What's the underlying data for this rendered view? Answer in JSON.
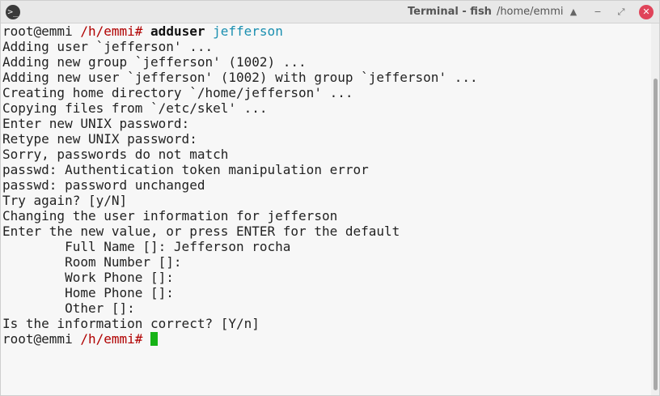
{
  "window": {
    "title": "Terminal - fish",
    "path": "/home/emmi",
    "icon": ">_",
    "buttons": {
      "shade": "▲",
      "minimize": "−",
      "maximize": "⤢",
      "close": "✕"
    }
  },
  "colors": {
    "prompt_path": "#b00000",
    "argument": "#1a8fb0",
    "cursor": "#16b316",
    "close": "#e0445a"
  },
  "terminal": {
    "prompt1": {
      "user": "root@emmi",
      "path": "/h/emmi#",
      "command": "adduser",
      "argument": "jefferson"
    },
    "output": [
      "Adding user `jefferson' ...",
      "Adding new group `jefferson' (1002) ...",
      "Adding new user `jefferson' (1002) with group `jefferson' ...",
      "Creating home directory `/home/jefferson' ...",
      "Copying files from `/etc/skel' ...",
      "Enter new UNIX password:",
      "Retype new UNIX password:",
      "Sorry, passwords do not match",
      "passwd: Authentication token manipulation error",
      "passwd: password unchanged",
      "Try again? [y/N]",
      "Changing the user information for jefferson",
      "Enter the new value, or press ENTER for the default",
      "        Full Name []: Jefferson rocha",
      "        Room Number []:",
      "        Work Phone []:",
      "        Home Phone []:",
      "        Other []:",
      "Is the information correct? [Y/n]"
    ],
    "prompt2": {
      "user": "root@emmi",
      "path": "/h/emmi#"
    }
  }
}
